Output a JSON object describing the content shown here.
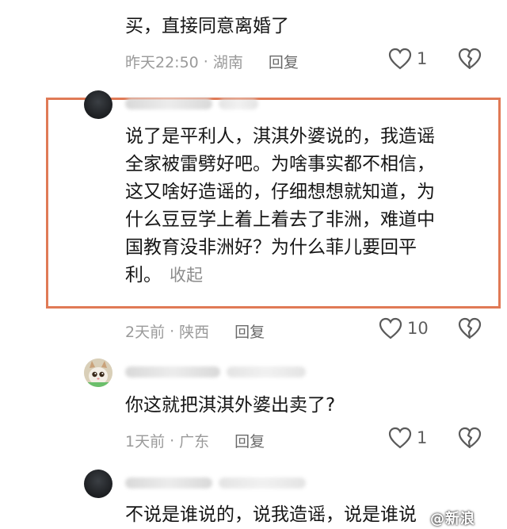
{
  "comments": [
    {
      "text": "买，直接同意离婚了",
      "time": "昨天22:50",
      "location": "湖南",
      "reply_label": "回复",
      "likes": "1"
    },
    {
      "text": "说了是平利人，淇淇外婆说的，我造谣全家被雷劈好吧。为啥事实都不相信，这又啥好造谣的，仔细想想就知道，为什么豆豆学上着上着去了非洲，难道中国教育没非洲好？为什么菲儿要回平利。",
      "text_lines": [
        "说了是平利人，淇淇外婆说的，我造谣",
        "全家被雷劈好吧。为啥事实都不相信，",
        "这又啥好造谣的，仔细想想就知道，为",
        "什么豆豆学上着上着去了非洲，难道中",
        "国教育没非洲好？为什么菲儿要回平",
        "利。"
      ],
      "collapse_label": "收起",
      "time": "2天前",
      "location": "陕西",
      "reply_label": "回复",
      "likes": "10"
    },
    {
      "text": "你这就把淇淇外婆出卖了?",
      "time": "1天前",
      "location": "广东",
      "reply_label": "回复",
      "likes": "1"
    },
    {
      "text": "不说是谁说的，说我造谣，说是谁说"
    }
  ],
  "separator": "·",
  "watermark": "@新浪"
}
